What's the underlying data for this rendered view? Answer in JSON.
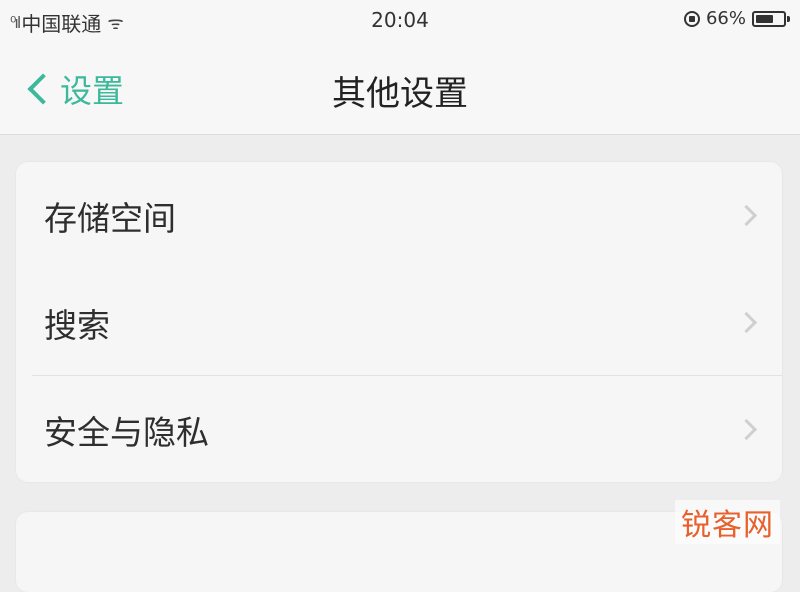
{
  "status_bar": {
    "carrier": "中国联通",
    "time": "20:04",
    "battery_percent": "66%",
    "battery_level": 0.66
  },
  "nav": {
    "back_label": "设置",
    "title": "其他设置"
  },
  "settings_group_1": {
    "items": [
      {
        "label": "存储空间"
      },
      {
        "label": "搜索"
      },
      {
        "label": "安全与隐私"
      }
    ]
  },
  "watermark": "锐客网",
  "colors": {
    "accent": "#3cb89a",
    "background": "#ededed",
    "card": "#f6f6f6",
    "watermark": "#e8602c"
  }
}
